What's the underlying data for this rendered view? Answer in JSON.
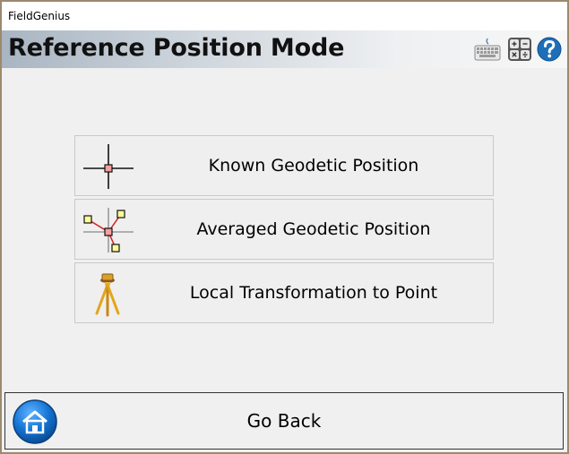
{
  "app": {
    "window_title": "FieldGenius"
  },
  "header": {
    "title": "Reference Position Mode",
    "icons": [
      "keyboard-icon",
      "calculator-icon",
      "help-icon"
    ]
  },
  "options": [
    {
      "label": "Known Geodetic Position",
      "icon": "crosshair-point-icon"
    },
    {
      "label": "Averaged Geodetic Position",
      "icon": "averaged-points-icon"
    },
    {
      "label": "Local Transformation to Point",
      "icon": "tripod-icon"
    }
  ],
  "footer": {
    "back_label": "Go Back",
    "icon": "home-icon"
  },
  "colors": {
    "header_gradient_start": "#a9b5c2",
    "background": "#f0f0f0",
    "accent_blue": "#1e6fb8"
  }
}
